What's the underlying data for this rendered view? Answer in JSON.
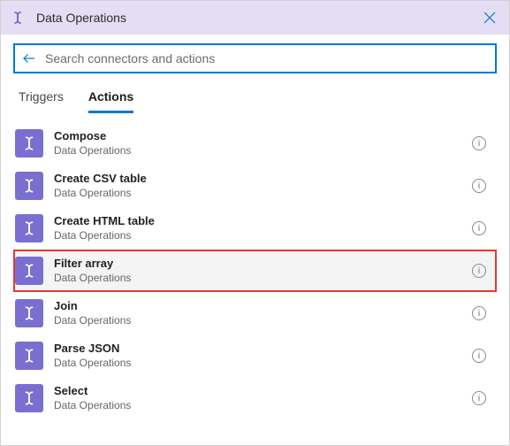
{
  "header": {
    "title": "Data Operations"
  },
  "search": {
    "placeholder": "Search connectors and actions",
    "value": ""
  },
  "tabs": {
    "triggers": "Triggers",
    "actions": "Actions",
    "active": "actions"
  },
  "actions": [
    {
      "name": "Compose",
      "connector": "Data Operations",
      "highlighted": false
    },
    {
      "name": "Create CSV table",
      "connector": "Data Operations",
      "highlighted": false
    },
    {
      "name": "Create HTML table",
      "connector": "Data Operations",
      "highlighted": false
    },
    {
      "name": "Filter array",
      "connector": "Data Operations",
      "highlighted": true
    },
    {
      "name": "Join",
      "connector": "Data Operations",
      "highlighted": false
    },
    {
      "name": "Parse JSON",
      "connector": "Data Operations",
      "highlighted": false
    },
    {
      "name": "Select",
      "connector": "Data Operations",
      "highlighted": false
    }
  ],
  "colors": {
    "accent": "#0078d4",
    "connectorTile": "#7a6fd1",
    "titlebar": "#e5ddf4",
    "highlightOutline": "#e03b2f"
  }
}
